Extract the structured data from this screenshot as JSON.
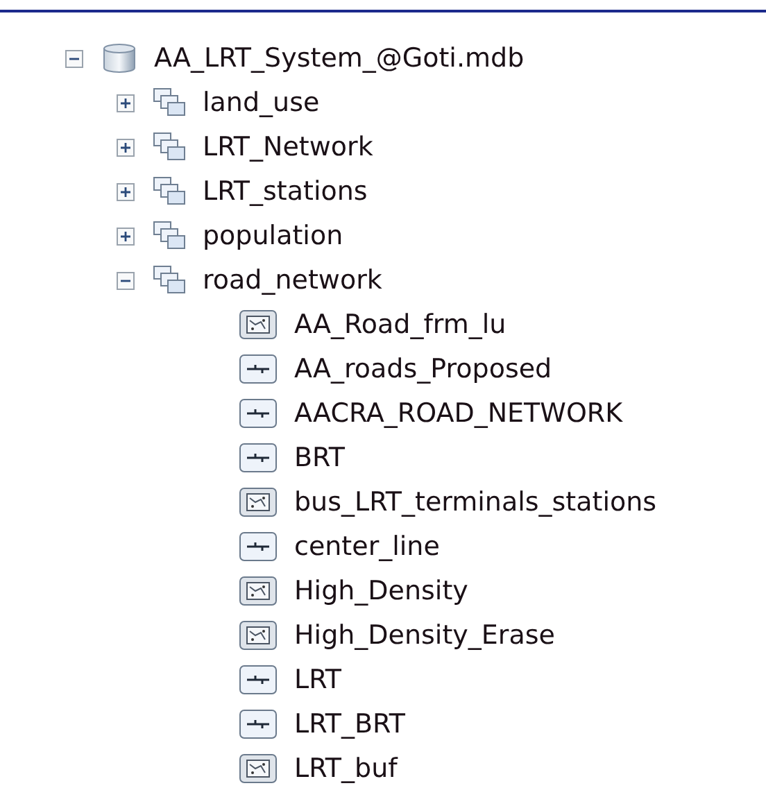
{
  "tree": [
    {
      "name": "AA_LRT_System_@Goti.mdb",
      "kind": "database",
      "expanded": true,
      "children": [
        {
          "name": "land_use",
          "kind": "dataset",
          "expanded": false
        },
        {
          "name": "LRT_Network",
          "kind": "dataset",
          "expanded": false
        },
        {
          "name": "LRT_stations",
          "kind": "dataset",
          "expanded": false
        },
        {
          "name": "population",
          "kind": "dataset",
          "expanded": false
        },
        {
          "name": "road_network",
          "kind": "dataset",
          "expanded": true,
          "children": [
            {
              "name": "AA_Road_frm_lu",
              "kind": "polygon"
            },
            {
              "name": "AA_roads_Proposed",
              "kind": "line"
            },
            {
              "name": "AACRA_ROAD_NETWORK",
              "kind": "line"
            },
            {
              "name": "BRT",
              "kind": "line"
            },
            {
              "name": "bus_LRT_terminals_stations",
              "kind": "polygon"
            },
            {
              "name": "center_line",
              "kind": "line"
            },
            {
              "name": "High_Density",
              "kind": "polygon"
            },
            {
              "name": "High_Density_Erase",
              "kind": "polygon"
            },
            {
              "name": "LRT",
              "kind": "line"
            },
            {
              "name": "LRT_BRT",
              "kind": "line"
            },
            {
              "name": "LRT_buf",
              "kind": "polygon"
            }
          ]
        }
      ]
    }
  ]
}
